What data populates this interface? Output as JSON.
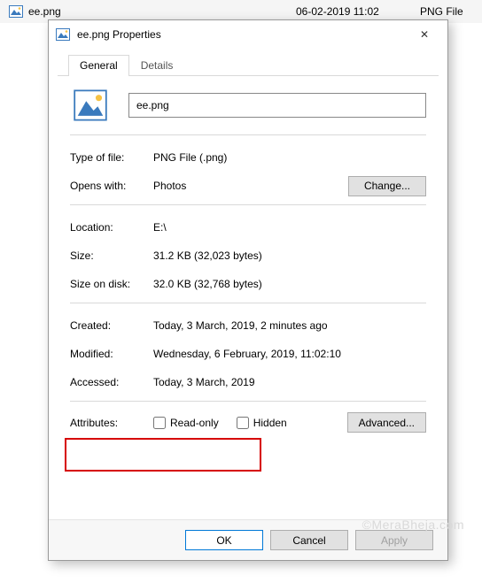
{
  "explorer_row": {
    "name": "ee.png",
    "date": "06-02-2019 11:02",
    "type": "PNG File"
  },
  "dialog": {
    "title": "ee.png Properties",
    "close_glyph": "✕"
  },
  "tabs": {
    "general": "General",
    "details": "Details"
  },
  "file": {
    "name": "ee.png"
  },
  "fields": {
    "type_label": "Type of file:",
    "type_value": "PNG File (.png)",
    "opens_label": "Opens with:",
    "opens_value": "Photos",
    "change_btn": "Change...",
    "location_label": "Location:",
    "location_value": "E:\\",
    "size_label": "Size:",
    "size_value": "31.2 KB (32,023 bytes)",
    "sizeod_label": "Size on disk:",
    "sizeod_value": "32.0 KB (32,768 bytes)",
    "created_label": "Created:",
    "created_value": "Today, 3 March, 2019, 2 minutes ago",
    "modified_label": "Modified:",
    "modified_value": "Wednesday, 6 February, 2019, 11:02:10",
    "accessed_label": "Accessed:",
    "accessed_value": "Today, 3 March, 2019",
    "attributes_label": "Attributes:",
    "readonly_label": "Read-only",
    "hidden_label": "Hidden",
    "advanced_btn": "Advanced..."
  },
  "footer": {
    "ok": "OK",
    "cancel": "Cancel",
    "apply": "Apply"
  },
  "watermark": "©MeraBheja.com"
}
